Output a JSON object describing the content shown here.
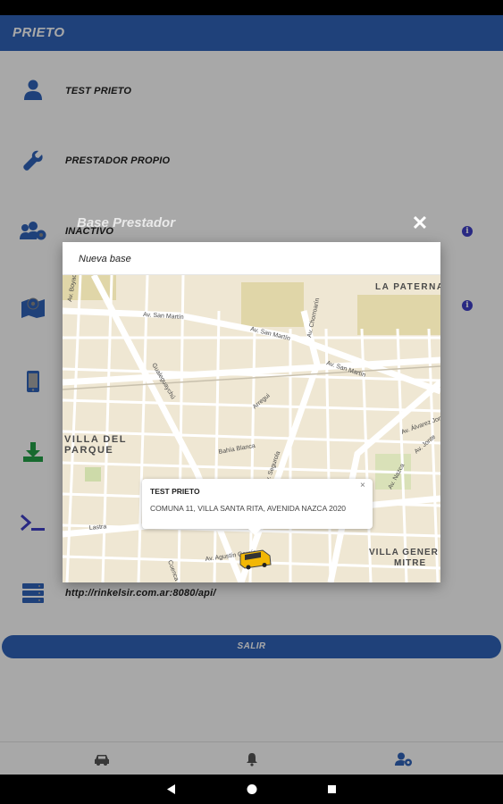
{
  "app_bar": {
    "title": "PRIETO"
  },
  "profile": {
    "user_name": "TEST PRIETO",
    "provider_type": "PRESTADOR PROPIO",
    "status": "INACTIVO",
    "api_url": "http://rinkelsir.com.ar:8080/api/"
  },
  "actions": {
    "logout_label": "SALIR"
  },
  "icons": {
    "user": "person-icon",
    "provider": "wrench-icon",
    "status": "users-gear-icon",
    "base": "map-pin-icon",
    "device": "phone-icon",
    "download": "download-icon",
    "console": "terminal-icon",
    "server": "server-icon",
    "info": "info-icon"
  },
  "bottom_nav": [
    "car-icon",
    "bell-icon",
    "user-settings-icon"
  ],
  "dialog": {
    "title": "Base Prestador",
    "input_placeholder": "Nueva base",
    "map": {
      "labels": {
        "la_paternal": "LA PATERNA",
        "villa_del_parque_1": "VILLA DEL",
        "villa_del_parque_2": "PARQUE",
        "villa_general_mitre_1": "VILLA GENER",
        "villa_general_mitre_2": "MITRE",
        "av_san_martin_1": "Av. San Martín",
        "av_san_martin_2": "Av. San Martín",
        "av_san_martin_3": "Av. San Martín",
        "av_chorroarin": "Av. Chorroarín",
        "av_nazca": "Av. Nazca",
        "av_jonte": "Av. Jonte",
        "lastra": "Lastra",
        "av_alvarez_jonte": "Av. Álvarez Jonte",
        "av_boyaca": "Av. Boyacá",
        "gualeguaychu": "Gualeguaychú",
        "av_agustin": "Av. Agustín García",
        "cuenca": "Cuenca",
        "bahia_blanca": "Bahía Blanca",
        "av_segurola": "Av. Segurola",
        "arregui": "Arregui"
      },
      "popup": {
        "title": "TEST PRIETO",
        "address": "COMUNA 11, VILLA SANTA RITA, AVENIDA NAZCA 2020",
        "close": "×"
      }
    }
  },
  "colors": {
    "primary": "#2f63ba",
    "icon_blue": "#2f63ba",
    "icon_green": "#24a148",
    "icon_purple": "#3f3fc7",
    "map_bg": "#efe7d3"
  }
}
